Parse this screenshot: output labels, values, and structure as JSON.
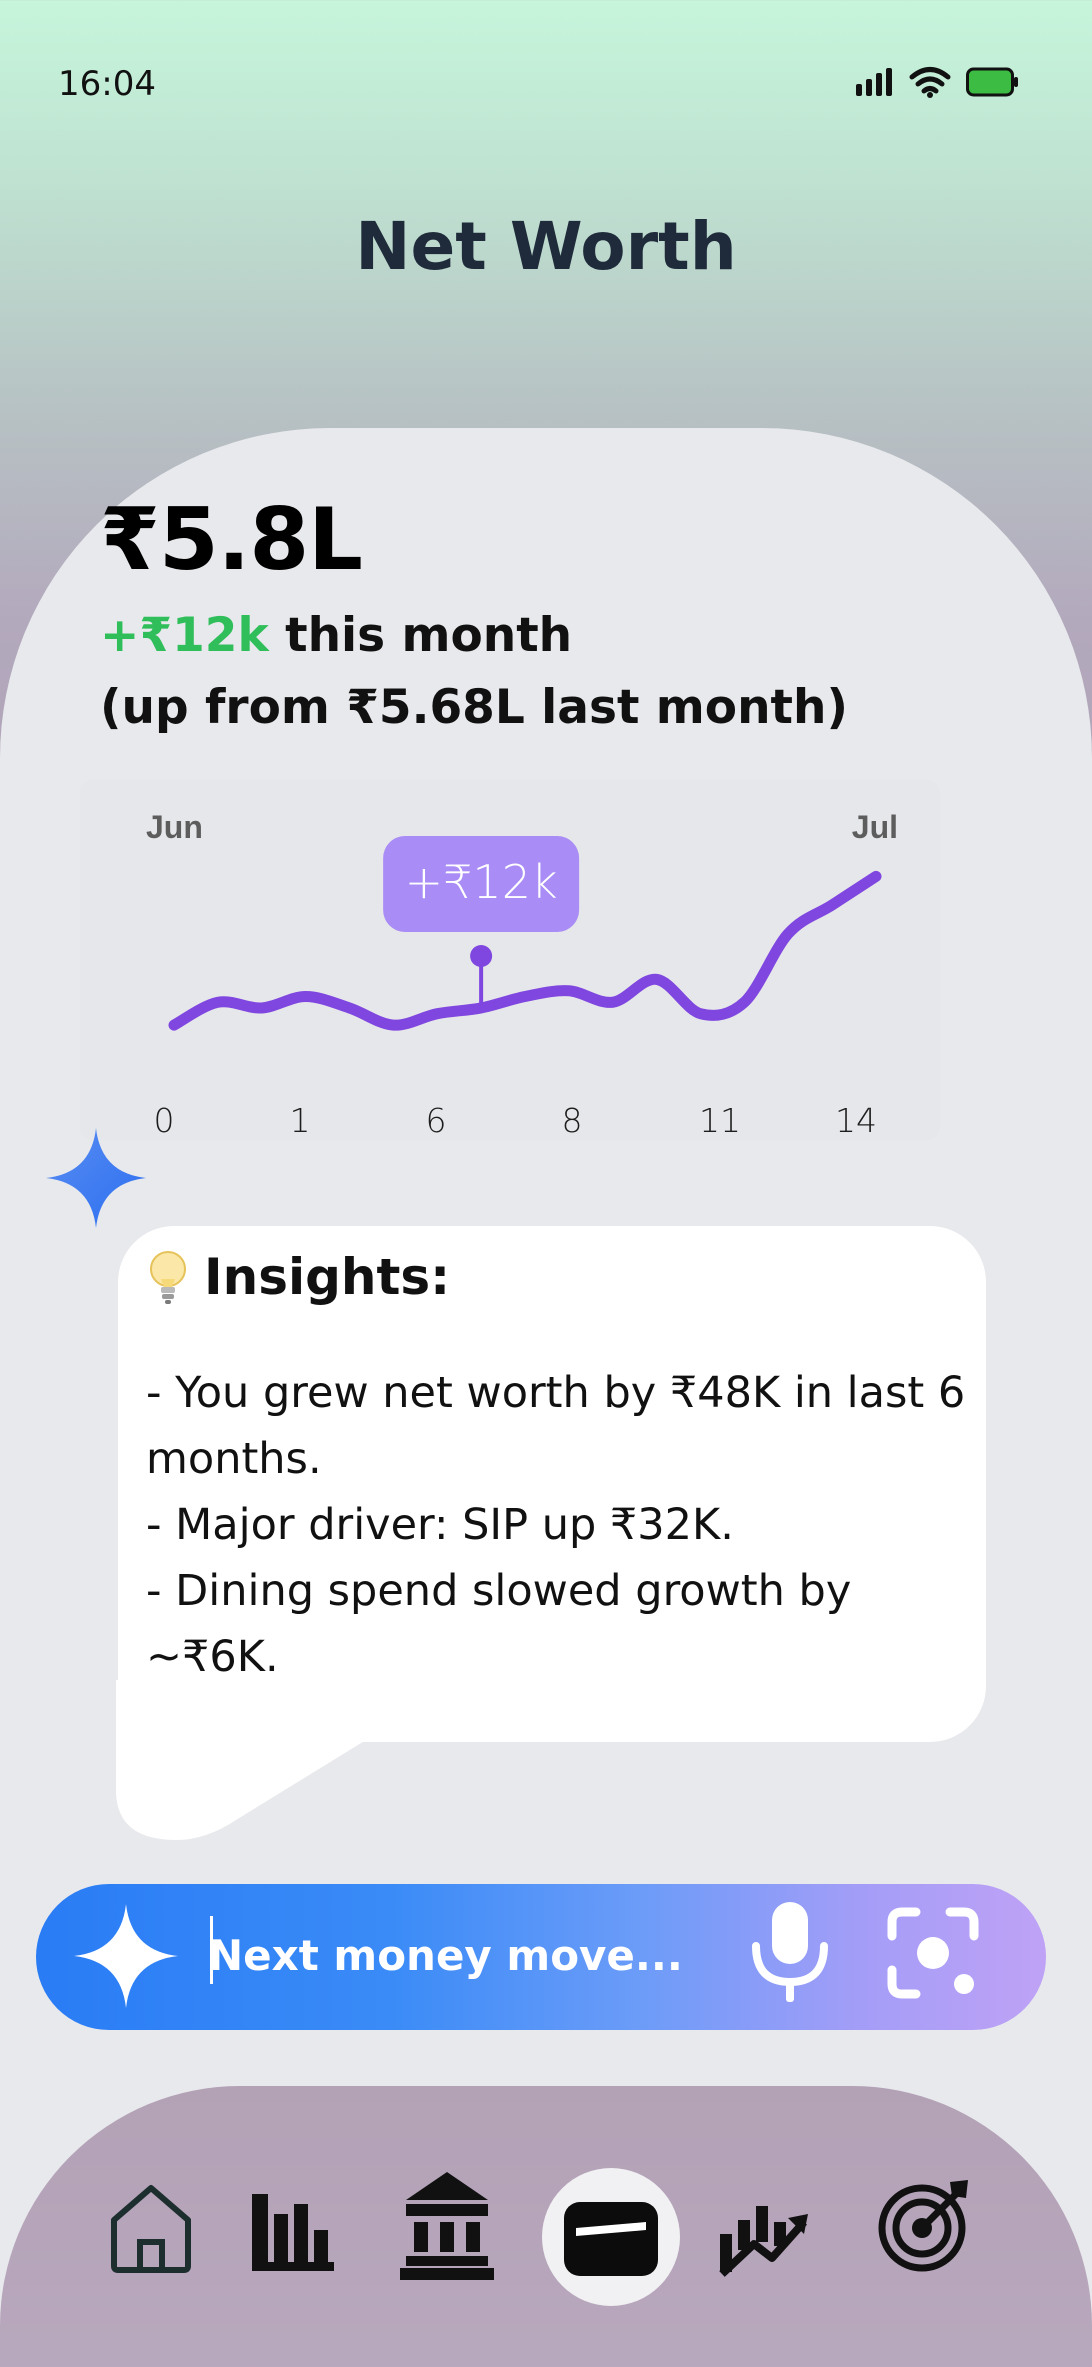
{
  "status_bar": {
    "time": "16:04"
  },
  "header": {
    "title": "Net Worth"
  },
  "summary": {
    "value": "₹5.8L",
    "delta_amount": "+₹12k",
    "delta_suffix": " this month",
    "previous": "(up from ₹5.68L last month)"
  },
  "chart_data": {
    "type": "line",
    "start_label": "Jun",
    "end_label": "Jul",
    "x_tick_labels": [
      "0",
      "1",
      "6",
      "8",
      "11",
      "14"
    ],
    "x": [
      0,
      1,
      2,
      3,
      4,
      5,
      6,
      7,
      8,
      9,
      10,
      11,
      12,
      13,
      14,
      15,
      16
    ],
    "values": [
      24,
      28,
      27,
      29,
      27,
      24,
      26,
      27,
      29,
      30,
      28,
      32,
      26,
      28,
      40,
      45,
      50
    ],
    "highlight": {
      "label": "+₹12k",
      "x_index": 7
    },
    "line_color": "#7f46e0",
    "callout_color": "#a98cf5"
  },
  "insights": {
    "icon": "lightbulb-icon",
    "title": "Insights:",
    "lines": [
      "- You grew net worth by ₹48K in last 6 months.",
      "- Major driver: SIP up ₹32K.",
      "- Dining spend slowed growth by ~₹6K."
    ]
  },
  "prompt": {
    "placeholder": "Next money move..."
  },
  "nav": {
    "items": [
      "home-icon",
      "bar-chart-icon",
      "bank-icon",
      "wallet-icon",
      "trending-icon",
      "target-icon"
    ],
    "selected": "wallet-icon"
  }
}
